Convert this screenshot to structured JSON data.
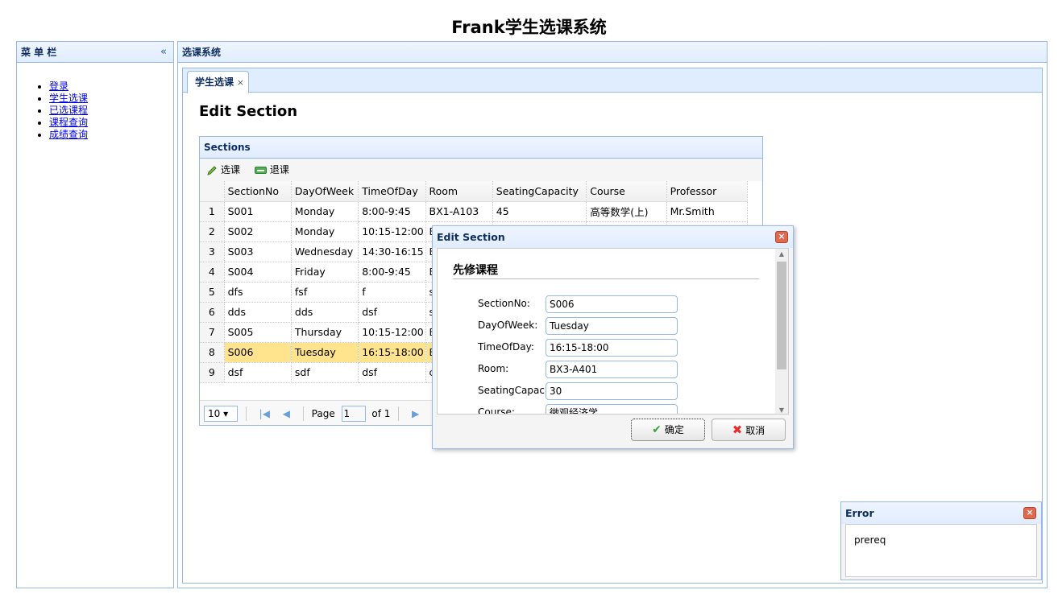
{
  "app": {
    "title": "Frank学生选课系统"
  },
  "sidebar": {
    "title": "菜 单 栏",
    "collapse_glyph": "«",
    "items": [
      {
        "label": "登录"
      },
      {
        "label": "学生选课"
      },
      {
        "label": "已选课程"
      },
      {
        "label": "课程查询"
      },
      {
        "label": "成绩查询"
      }
    ]
  },
  "main": {
    "title": "选课系统",
    "tab": {
      "label": "学生选课",
      "close": "×"
    },
    "heading": "Edit Section"
  },
  "grid": {
    "title": "Sections",
    "toolbar": {
      "add_label": "选课",
      "remove_label": "退课"
    },
    "columns": [
      "SectionNo",
      "DayOfWeek",
      "TimeOfDay",
      "Room",
      "SeatingCapacity",
      "Course",
      "Professor"
    ],
    "rows": [
      {
        "n": "1",
        "cells": [
          "S001",
          "Monday",
          "8:00-9:45",
          "BX1-A103",
          "45",
          "高等数学(上)",
          "Mr.Smith"
        ]
      },
      {
        "n": "2",
        "cells": [
          "S002",
          "Monday",
          "10:15-12:00",
          "B",
          "",
          "",
          ""
        ]
      },
      {
        "n": "3",
        "cells": [
          "S003",
          "Wednesday",
          "14:30-16:15",
          "B",
          "",
          "",
          ""
        ]
      },
      {
        "n": "4",
        "cells": [
          "S004",
          "Friday",
          "8:00-9:45",
          "B",
          "",
          "",
          ""
        ]
      },
      {
        "n": "5",
        "cells": [
          "dfs",
          "fsf",
          "f",
          "s",
          "",
          "",
          ""
        ]
      },
      {
        "n": "6",
        "cells": [
          "dds",
          "dds",
          "dsf",
          "s",
          "",
          "",
          ""
        ]
      },
      {
        "n": "7",
        "cells": [
          "S005",
          "Thursday",
          "10:15-12:00",
          "B",
          "",
          "",
          ""
        ]
      },
      {
        "n": "8",
        "cells": [
          "S006",
          "Tuesday",
          "16:15-18:00",
          "B",
          "",
          "",
          ""
        ],
        "selected": true
      },
      {
        "n": "9",
        "cells": [
          "dsf",
          "sdf",
          "dsf",
          "c",
          "",
          "",
          ""
        ]
      }
    ],
    "pager": {
      "page_size": "10",
      "page_label": "Page",
      "page_value": "1",
      "of_label": "of 1"
    }
  },
  "dialog": {
    "title": "Edit Section",
    "close_glyph": "×",
    "form_heading": "先修课程",
    "fields": [
      {
        "label": "SectionNo:",
        "value": "S006"
      },
      {
        "label": "DayOfWeek:",
        "value": "Tuesday"
      },
      {
        "label": "TimeOfDay:",
        "value": "16:15-18:00"
      },
      {
        "label": "Room:",
        "value": "BX3-A401"
      },
      {
        "label": "SeatingCapacity:",
        "value": "30"
      },
      {
        "label": "Course:",
        "value": "微观经济学"
      }
    ],
    "ok_label": "确定",
    "cancel_label": "取消"
  },
  "error": {
    "title": "Error",
    "close_glyph": "×",
    "message": "prereq"
  },
  "colors": {
    "border": "#95b8e7",
    "header_text": "#0e2d5f",
    "selected_row": "#ffe48d",
    "close_button": "#e06a4f"
  }
}
